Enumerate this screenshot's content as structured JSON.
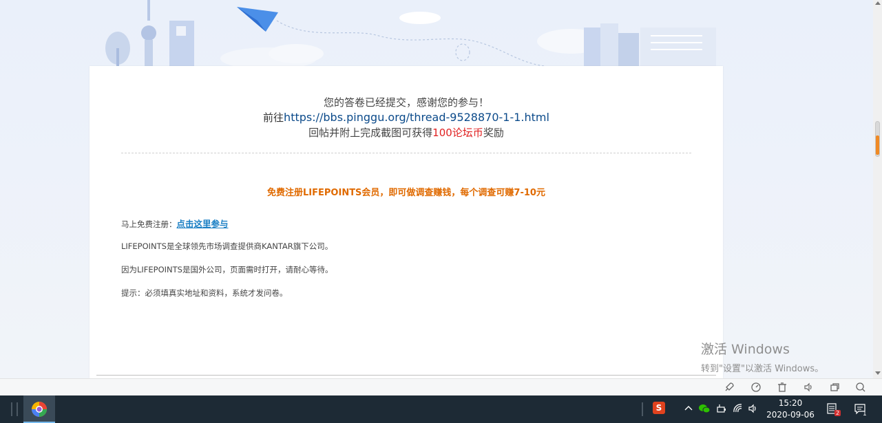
{
  "survey": {
    "line1": "您的答卷已经提交，感谢您的参与！",
    "line2_prefix": "前往",
    "line2_link": "https://bbs.pinggu.org/thread-9528870-1-1.html",
    "line3_prefix": "回帖并附上完成截图可获得",
    "line3_highlight": "100论坛币",
    "line3_suffix": "奖励"
  },
  "promo": {
    "headline": "免费注册LIFEPOINTS会员，即可做调查赚钱，每个调查可赚7-10元",
    "register_label": "马上免费注册：",
    "register_link": "点击这里参与",
    "info1": "LIFEPOINTS是全球领先市场调查提供商KANTAR旗下公司。",
    "info2": "因为LIFEPOINTS是国外公司，页面需时打开，请耐心等待。",
    "info3": "提示：必须填真实地址和资料，系统才发问卷。"
  },
  "watermark": {
    "title": "激活 Windows",
    "subtitle": "转到\"设置\"以激活 Windows。"
  },
  "statusbar": {
    "icons": [
      "rocket-icon",
      "speed-icon",
      "trash-icon",
      "volume-icon",
      "window-icon",
      "search-icon"
    ]
  },
  "taskbar": {
    "time": "15:20",
    "date": "2020-09-06",
    "notification_badge": "2",
    "message_count": "1"
  },
  "colors": {
    "accent_link": "#0b4a8a",
    "highlight_red": "#e02020",
    "promo_orange": "#e06a00",
    "register_blue": "#1a7fc4"
  }
}
